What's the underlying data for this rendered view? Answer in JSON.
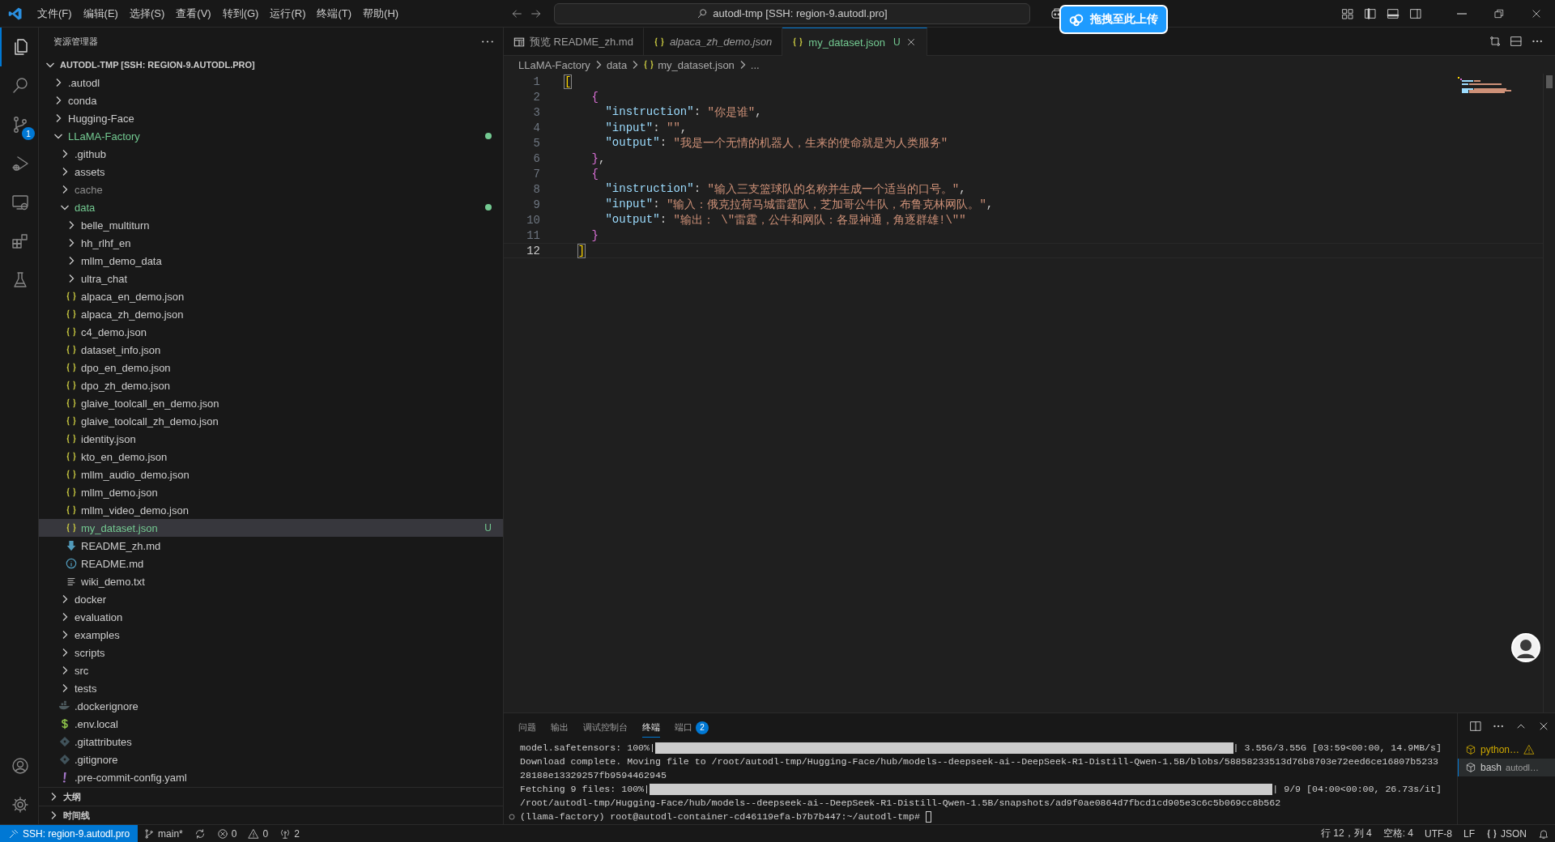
{
  "title_bar": {
    "menu": [
      "文件(F)",
      "编辑(E)",
      "选择(S)",
      "查看(V)",
      "转到(G)",
      "运行(R)",
      "终端(T)",
      "帮助(H)"
    ],
    "search": "autodl-tmp [SSH: region-9.autodl.pro]",
    "upload_button": "拖拽至此上传"
  },
  "activity_bar": [
    {
      "kind": "explorer",
      "selected": true
    },
    {
      "kind": "search",
      "selected": false
    },
    {
      "kind": "source-control",
      "selected": false,
      "badge": "1"
    },
    {
      "kind": "run-debug",
      "selected": false
    },
    {
      "kind": "remote",
      "selected": false
    },
    {
      "kind": "extensions",
      "selected": false
    },
    {
      "kind": "testing",
      "selected": false
    }
  ],
  "activity_bar_bottom": [
    {
      "kind": "account"
    },
    {
      "kind": "settings"
    }
  ],
  "sidebar": {
    "title": "资源管理器",
    "root": {
      "label": "AUTODL-TMP [SSH: REGION-9.AUTODL.PRO]",
      "expanded": true,
      "children": [
        {
          "label": ".autodl",
          "kind": "folder",
          "expanded": false,
          "selected": false
        },
        {
          "label": "conda",
          "kind": "folder",
          "expanded": false,
          "selected": false
        },
        {
          "label": "Hugging-Face",
          "kind": "folder",
          "expanded": false,
          "selected": false
        },
        {
          "label": "LLaMA-Factory",
          "kind": "folder",
          "expanded": true,
          "selected": false,
          "color": "#73c991",
          "modified": true,
          "children": [
            {
              "label": ".github",
              "kind": "folder",
              "expanded": false,
              "selected": false
            },
            {
              "label": "assets",
              "kind": "folder",
              "expanded": false,
              "selected": false
            },
            {
              "label": "cache",
              "kind": "folder",
              "expanded": false,
              "selected": false,
              "color": "#8c8c8c"
            },
            {
              "label": "data",
              "kind": "folder",
              "expanded": true,
              "selected": false,
              "color": "#73c991",
              "modified": true,
              "children": [
                {
                  "label": "belle_multiturn",
                  "kind": "folder",
                  "expanded": false,
                  "selected": false
                },
                {
                  "label": "hh_rlhf_en",
                  "kind": "folder",
                  "expanded": false,
                  "selected": false
                },
                {
                  "label": "mllm_demo_data",
                  "kind": "folder",
                  "expanded": false,
                  "selected": false
                },
                {
                  "label": "ultra_chat",
                  "kind": "folder",
                  "expanded": false,
                  "selected": false
                },
                {
                  "label": "alpaca_en_demo.json",
                  "kind": "json",
                  "selected": false
                },
                {
                  "label": "alpaca_zh_demo.json",
                  "kind": "json",
                  "selected": false
                },
                {
                  "label": "c4_demo.json",
                  "kind": "json",
                  "selected": false
                },
                {
                  "label": "dataset_info.json",
                  "kind": "json",
                  "selected": false
                },
                {
                  "label": "dpo_en_demo.json",
                  "kind": "json",
                  "selected": false
                },
                {
                  "label": "dpo_zh_demo.json",
                  "kind": "json",
                  "selected": false
                },
                {
                  "label": "glaive_toolcall_en_demo.json",
                  "kind": "json",
                  "selected": false
                },
                {
                  "label": "glaive_toolcall_zh_demo.json",
                  "kind": "json",
                  "selected": false
                },
                {
                  "label": "identity.json",
                  "kind": "json",
                  "selected": false
                },
                {
                  "label": "kto_en_demo.json",
                  "kind": "json",
                  "selected": false
                },
                {
                  "label": "mllm_audio_demo.json",
                  "kind": "json",
                  "selected": false
                },
                {
                  "label": "mllm_demo.json",
                  "kind": "json",
                  "selected": false
                },
                {
                  "label": "mllm_video_demo.json",
                  "kind": "json",
                  "selected": false
                },
                {
                  "label": "my_dataset.json",
                  "kind": "json",
                  "selected": true,
                  "color": "#73c991",
                  "badge": "U"
                },
                {
                  "label": "README_zh.md",
                  "kind": "markdown",
                  "selected": false
                },
                {
                  "label": "README.md",
                  "kind": "info",
                  "selected": false
                },
                {
                  "label": "wiki_demo.txt",
                  "kind": "text",
                  "selected": false
                }
              ]
            },
            {
              "label": "docker",
              "kind": "folder",
              "expanded": false,
              "selected": false
            },
            {
              "label": "evaluation",
              "kind": "folder",
              "expanded": false,
              "selected": false
            },
            {
              "label": "examples",
              "kind": "folder",
              "expanded": false,
              "selected": false
            },
            {
              "label": "scripts",
              "kind": "folder",
              "expanded": false,
              "selected": false
            },
            {
              "label": "src",
              "kind": "folder",
              "expanded": false,
              "selected": false
            },
            {
              "label": "tests",
              "kind": "folder",
              "expanded": false,
              "selected": false
            },
            {
              "label": ".dockerignore",
              "kind": "docker",
              "selected": false
            },
            {
              "label": ".env.local",
              "kind": "env",
              "selected": false
            },
            {
              "label": ".gitattributes",
              "kind": "git",
              "selected": false
            },
            {
              "label": ".gitignore",
              "kind": "git",
              "selected": false
            },
            {
              "label": ".pre-commit-config.yaml",
              "kind": "yaml",
              "selected": false
            }
          ]
        }
      ]
    },
    "sections": [
      {
        "label": "大纲",
        "expanded": false
      },
      {
        "label": "时间线",
        "expanded": false
      }
    ]
  },
  "editor": {
    "tabs": [
      {
        "label": "预览 README_zh.md",
        "kind": "preview",
        "preview": false,
        "selected": false
      },
      {
        "label": "alpaca_zh_demo.json",
        "kind": "json",
        "preview": true,
        "selected": false
      },
      {
        "label": "my_dataset.json",
        "kind": "json",
        "preview": false,
        "selected": true,
        "color": "#73c991",
        "badge": "U"
      }
    ],
    "breadcrumb": [
      {
        "label": "LLaMA-Factory",
        "kind": "folder"
      },
      {
        "label": "data",
        "kind": "folder"
      },
      {
        "label": "my_dataset.json",
        "kind": "json"
      },
      {
        "label": "...",
        "kind": "more"
      }
    ],
    "code_lines": [
      {
        "number": "1",
        "current": false,
        "tokens": [
          {
            "kind": "bracket-match",
            "text": "["
          }
        ]
      },
      {
        "number": "2",
        "current": false,
        "tokens": [
          {
            "kind": "brace",
            "text": "    {"
          }
        ]
      },
      {
        "number": "3",
        "current": false,
        "tokens": [
          {
            "kind": "key",
            "text": "      \"instruction\""
          },
          {
            "kind": "punct",
            "text": ": "
          },
          {
            "kind": "string",
            "text": "\"你是谁\""
          },
          {
            "kind": "punct",
            "text": ","
          }
        ]
      },
      {
        "number": "4",
        "current": false,
        "tokens": [
          {
            "kind": "key",
            "text": "      \"input\""
          },
          {
            "kind": "punct",
            "text": ": "
          },
          {
            "kind": "string",
            "text": "\"\""
          },
          {
            "kind": "punct",
            "text": ","
          }
        ]
      },
      {
        "number": "5",
        "current": false,
        "tokens": [
          {
            "kind": "key",
            "text": "      \"output\""
          },
          {
            "kind": "punct",
            "text": ": "
          },
          {
            "kind": "string",
            "text": "\"我是一个无情的机器人，生来的使命就是为人类服务\""
          }
        ]
      },
      {
        "number": "6",
        "current": false,
        "tokens": [
          {
            "kind": "brace",
            "text": "    }"
          },
          {
            "kind": "punct",
            "text": ","
          }
        ]
      },
      {
        "number": "7",
        "current": false,
        "tokens": [
          {
            "kind": "brace",
            "text": "    {"
          }
        ]
      },
      {
        "number": "8",
        "current": false,
        "tokens": [
          {
            "kind": "key",
            "text": "      \"instruction\""
          },
          {
            "kind": "punct",
            "text": ": "
          },
          {
            "kind": "string",
            "text": "\"输入三支篮球队的名称并生成一个适当的口号。\""
          },
          {
            "kind": "punct",
            "text": ","
          }
        ]
      },
      {
        "number": "9",
        "current": false,
        "tokens": [
          {
            "kind": "key",
            "text": "      \"input\""
          },
          {
            "kind": "punct",
            "text": ": "
          },
          {
            "kind": "string",
            "text": "\"输入：俄克拉荷马城雷霆队，芝加哥公牛队，布鲁克林网队。\""
          },
          {
            "kind": "punct",
            "text": ","
          }
        ]
      },
      {
        "number": "10",
        "current": false,
        "tokens": [
          {
            "kind": "key",
            "text": "      \"output\""
          },
          {
            "kind": "punct",
            "text": ": "
          },
          {
            "kind": "string",
            "text": "\"输出： \\\"雷霆，公牛和网队：各显神通，角逐群雄!\\\"\""
          }
        ]
      },
      {
        "number": "11",
        "current": false,
        "tokens": [
          {
            "kind": "brace",
            "text": "    }"
          }
        ]
      },
      {
        "number": "12",
        "current": true,
        "tokens": [
          {
            "kind": "bracket-match",
            "text": "  ]"
          }
        ]
      }
    ]
  },
  "panel": {
    "tabs": [
      {
        "label": "问题",
        "selected": false
      },
      {
        "label": "输出",
        "selected": false
      },
      {
        "label": "调试控制台",
        "selected": false
      },
      {
        "label": "终端",
        "selected": true
      },
      {
        "label": "端口",
        "selected": false,
        "badge": "2"
      }
    ],
    "terminal_lines": [
      {
        "kind": "progress",
        "prefix": "model.safetensors: 100%|",
        "level": 1,
        "suffix": "| 3.55G/3.55G [03:59<00:00, 14.9MB/s]"
      },
      {
        "kind": "text",
        "text": "Download complete. Moving file to /root/autodl-tmp/Hugging-Face/hub/models--deepseek-ai--DeepSeek-R1-Distill-Qwen-1.5B/blobs/58858233513d76b8703e72eed6ce16807b5233"
      },
      {
        "kind": "text",
        "text": "28188e13329257fb9594462945"
      },
      {
        "kind": "progress",
        "prefix": "Fetching 9 files: 100%|",
        "level": 1,
        "suffix": "| 9/9 [04:00<00:00, 26.73s/it]"
      },
      {
        "kind": "text",
        "text": "/root/autodl-tmp/Hugging-Face/hub/models--deepseek-ai--DeepSeek-R1-Distill-Qwen-1.5B/snapshots/ad9f0ae0864d7fbcd1cd905e3c6c5b069cc8b562"
      },
      {
        "kind": "prompt",
        "text": "(llama-factory) root@autodl-container-cd46119efa-b7b7b447:~/autodl-tmp#"
      }
    ],
    "terminals": [
      {
        "label": "python…",
        "warning": true,
        "selected": false
      },
      {
        "label": "bash",
        "detail": "autodl…",
        "warning": false,
        "selected": true
      }
    ]
  },
  "status_bar": {
    "left": [
      {
        "kind": "remote",
        "text": "SSH: region-9.autodl.pro"
      },
      {
        "kind": "branch",
        "text": "main*"
      },
      {
        "kind": "sync"
      },
      {
        "kind": "errors",
        "text": "0"
      },
      {
        "kind": "warnings",
        "text": "0"
      },
      {
        "kind": "ports",
        "text": "2"
      }
    ],
    "right": [
      {
        "kind": "text",
        "text": "行 12，列 4"
      },
      {
        "kind": "text",
        "text": "空格: 4"
      },
      {
        "kind": "text",
        "text": "UTF-8"
      },
      {
        "kind": "text",
        "text": "LF"
      },
      {
        "kind": "language",
        "text": "JSON"
      },
      {
        "kind": "bell"
      }
    ]
  }
}
